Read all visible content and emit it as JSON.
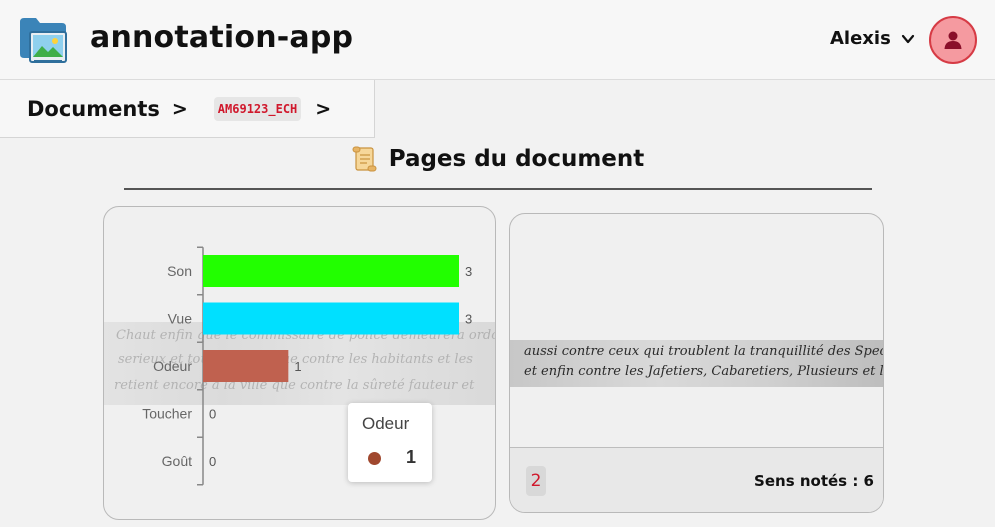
{
  "header": {
    "app_title": "annotation-app",
    "user_name": "Alexis",
    "logo_icon": "image-folder-icon",
    "avatar_icon": "user-icon",
    "avatar_color": "#f59aa0",
    "avatar_border": "#d63b45"
  },
  "breadcrumb": {
    "root": "Documents",
    "separator": ">",
    "document_id": "AM69123_ECH"
  },
  "section": {
    "title": "Pages du document",
    "icon": "scroll-icon"
  },
  "cards": [
    {
      "scan_lines": [
        "Chaut enfin que le commissaire de police demeurera ordonné",
        "serieux et toute la ville que contre les habitants et les",
        "retient encore a la ville que contre la sûreté fauteur et"
      ],
      "chart_data": {
        "type": "bar",
        "orientation": "horizontal",
        "categories": [
          "Son",
          "Vue",
          "Odeur",
          "Toucher",
          "Goût"
        ],
        "values": [
          3,
          3,
          1,
          0,
          0
        ],
        "colors": [
          "#22ff00",
          "#00e0ff",
          "#c0614f",
          "#cccccc",
          "#cccccc"
        ],
        "xlim": [
          0,
          3
        ],
        "grid": false,
        "legend": "none"
      },
      "tooltip": {
        "label": "Odeur",
        "value": "1",
        "color": "#a0482e"
      }
    },
    {
      "scan_lines": [
        "aussi contre ceux qui troublent la tranquillité des Spectacles,",
        "et enfin contre les Jafetiers, Cabaretiers, Plusieurs et les autres"
      ],
      "page_number": "2",
      "sens_label": "Sens notés : 6"
    }
  ]
}
